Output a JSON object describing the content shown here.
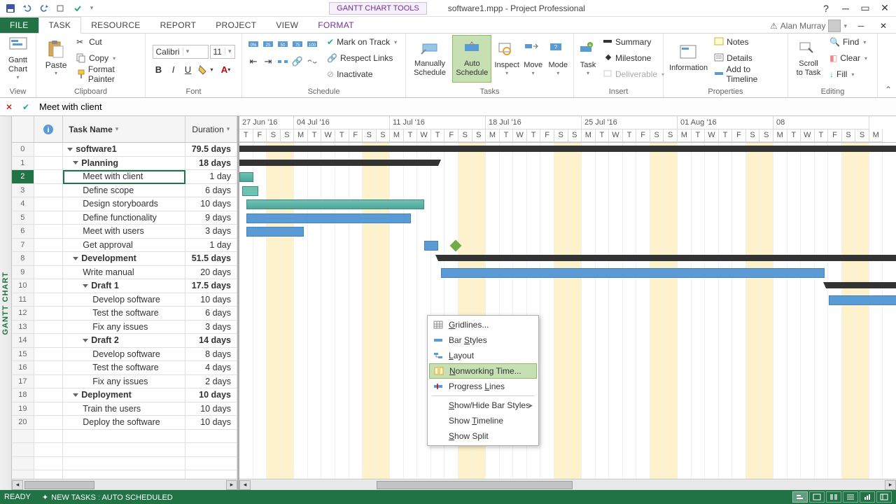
{
  "titlebar": {
    "tool_tab": "GANTT CHART TOOLS",
    "doc_title": "software1.mpp - Project Professional"
  },
  "ribbon_tabs": [
    "FILE",
    "TASK",
    "RESOURCE",
    "REPORT",
    "PROJECT",
    "VIEW",
    "FORMAT"
  ],
  "active_ribbon_tab": "TASK",
  "user": {
    "name": "Alan Murray"
  },
  "ribbon": {
    "view": {
      "gantt_chart": "Gantt\nChart",
      "label": "View"
    },
    "clipboard": {
      "paste": "Paste",
      "cut": "Cut",
      "copy": "Copy",
      "format_painter": "Format Painter",
      "label": "Clipboard"
    },
    "font": {
      "name": "Calibri",
      "size": "11",
      "label": "Font"
    },
    "schedule": {
      "mark_on_track": "Mark on Track",
      "respect_links": "Respect Links",
      "inactivate": "Inactivate",
      "label": "Schedule"
    },
    "tasks": {
      "manually": "Manually\nSchedule",
      "auto": "Auto\nSchedule",
      "inspect": "Inspect",
      "move": "Move",
      "mode": "Mode",
      "label": "Tasks"
    },
    "insert": {
      "task": "Task",
      "summary": "Summary",
      "milestone": "Milestone",
      "deliverable": "Deliverable",
      "label": "Insert"
    },
    "properties": {
      "information": "Information",
      "notes": "Notes",
      "details": "Details",
      "add_timeline": "Add to Timeline",
      "label": "Properties"
    },
    "editing": {
      "scroll_to_task": "Scroll\nto Task",
      "find": "Find",
      "clear": "Clear",
      "fill": "Fill",
      "label": "Editing"
    }
  },
  "formula_bar": {
    "value": "Meet with client"
  },
  "vtab": "GANTT CHART",
  "table": {
    "headers": {
      "info": "ⓘ",
      "name": "Task Name",
      "duration": "Duration"
    },
    "rows": [
      {
        "n": 0,
        "name": "software1",
        "dur": "79.5 days",
        "type": "summary",
        "indent": 0
      },
      {
        "n": 1,
        "name": "Planning",
        "dur": "18 days",
        "type": "summary",
        "indent": 1
      },
      {
        "n": 2,
        "name": "Meet with client",
        "dur": "1 day",
        "type": "task",
        "indent": 2,
        "selected": true
      },
      {
        "n": 3,
        "name": "Define scope",
        "dur": "6 days",
        "type": "task",
        "indent": 2
      },
      {
        "n": 4,
        "name": "Design storyboards",
        "dur": "10 days",
        "type": "task",
        "indent": 2
      },
      {
        "n": 5,
        "name": "Define functionality",
        "dur": "9 days",
        "type": "task",
        "indent": 2
      },
      {
        "n": 6,
        "name": "Meet with users",
        "dur": "3 days",
        "type": "task",
        "indent": 2
      },
      {
        "n": 7,
        "name": "Get approval",
        "dur": "1 day",
        "type": "task",
        "indent": 2
      },
      {
        "n": 8,
        "name": "Development",
        "dur": "51.5 days",
        "type": "summary",
        "indent": 1
      },
      {
        "n": 9,
        "name": "Write manual",
        "dur": "20 days",
        "type": "task",
        "indent": 2
      },
      {
        "n": 10,
        "name": "Draft 1",
        "dur": "17.5 days",
        "type": "summary",
        "indent": 2
      },
      {
        "n": 11,
        "name": "Develop software",
        "dur": "10 days",
        "type": "task",
        "indent": 3
      },
      {
        "n": 12,
        "name": "Test the software",
        "dur": "6 days",
        "type": "task",
        "indent": 3
      },
      {
        "n": 13,
        "name": "Fix any issues",
        "dur": "3 days",
        "type": "task",
        "indent": 3
      },
      {
        "n": 14,
        "name": "Draft 2",
        "dur": "14 days",
        "type": "summary",
        "indent": 2
      },
      {
        "n": 15,
        "name": "Develop software",
        "dur": "8 days",
        "type": "task",
        "indent": 3
      },
      {
        "n": 16,
        "name": "Test the software",
        "dur": "4 days",
        "type": "task",
        "indent": 3
      },
      {
        "n": 17,
        "name": "Fix any issues",
        "dur": "2 days",
        "type": "task",
        "indent": 3
      },
      {
        "n": 18,
        "name": "Deployment",
        "dur": "10 days",
        "type": "summary",
        "indent": 1
      },
      {
        "n": 19,
        "name": "Train the users",
        "dur": "10 days",
        "type": "task",
        "indent": 2
      },
      {
        "n": 20,
        "name": "Deploy the software",
        "dur": "10 days",
        "type": "task",
        "indent": 2
      }
    ]
  },
  "timescale": {
    "weeks": [
      "27 Jun '16",
      "04 Jul '16",
      "11 Jul '16",
      "18 Jul '16",
      "25 Jul '16",
      "01 Aug '16",
      "08"
    ],
    "days": [
      "T",
      "F",
      "S",
      "S",
      "M",
      "T",
      "W",
      "T",
      "F",
      "S",
      "S",
      "M",
      "T",
      "W",
      "T",
      "F",
      "S",
      "S",
      "M",
      "T",
      "W",
      "T",
      "F",
      "S",
      "S",
      "M",
      "T",
      "W",
      "T",
      "F",
      "S",
      "S",
      "M",
      "T",
      "W",
      "T",
      "F",
      "S",
      "S",
      "M",
      "T",
      "W",
      "T",
      "F",
      "S",
      "S",
      "M"
    ]
  },
  "context_menu": {
    "items": [
      {
        "label": "Gridlines...",
        "icon": "grid",
        "mn": "G"
      },
      {
        "label": "Bar Styles",
        "icon": "bar",
        "mn": "S"
      },
      {
        "label": "Layout",
        "icon": "layout",
        "mn": "L"
      },
      {
        "label": "Nonworking Time...",
        "icon": "nonworking",
        "highlighted": true,
        "mn": "N"
      },
      {
        "label": "Progress Lines",
        "icon": "progress",
        "mn": "L",
        "sep_after": true
      },
      {
        "label": "Show/Hide Bar Styles",
        "submenu": true,
        "mn": "S"
      },
      {
        "label": "Show Timeline",
        "mn": "T"
      },
      {
        "label": "Show Split",
        "mn": "S"
      }
    ]
  },
  "statusbar": {
    "ready": "READY",
    "new_tasks": "NEW TASKS : AUTO SCHEDULED"
  },
  "colors": {
    "accent": "#217346",
    "bar": "#5b9bd5",
    "active": "#c6e0b4"
  }
}
